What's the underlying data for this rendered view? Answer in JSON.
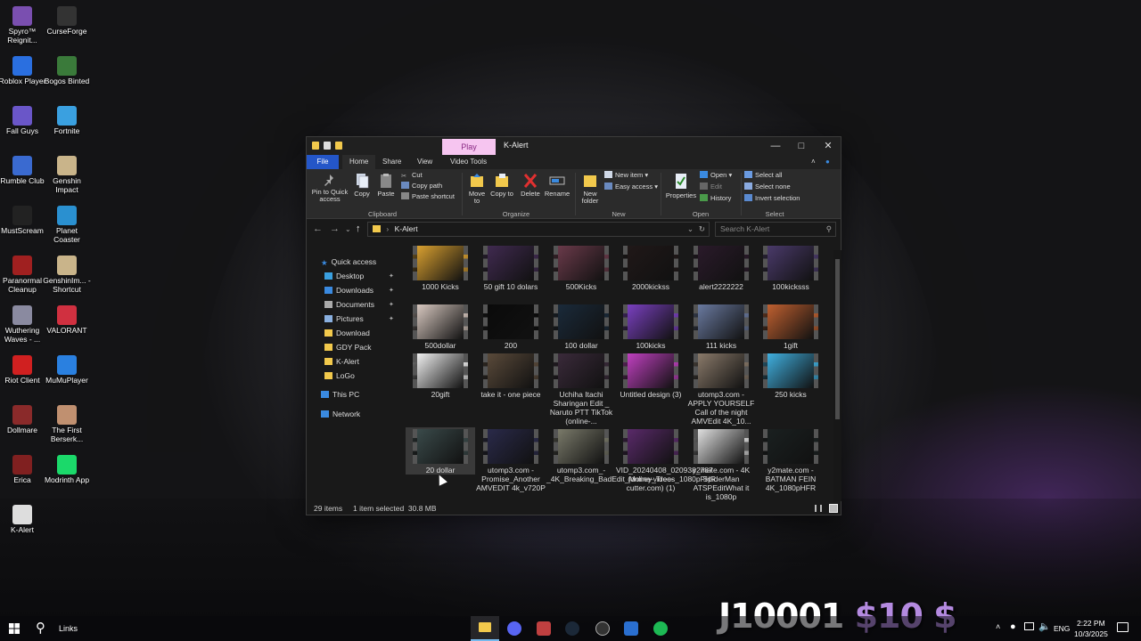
{
  "desktop": {
    "icons": [
      {
        "label": "Spyro™ Reignit...",
        "icon": "spyro-icon",
        "color": "#7a4fb0"
      },
      {
        "label": "CurseForge",
        "icon": "curseforge-icon",
        "color": "#333333"
      },
      {
        "label": "Roblox Player",
        "icon": "roblox-icon",
        "color": "#2a6fe0"
      },
      {
        "label": "Bogos Binted",
        "icon": "alien-icon",
        "color": "#3a7a3a"
      },
      {
        "label": "Fall Guys",
        "icon": "fallguys-icon",
        "color": "#6a56c8"
      },
      {
        "label": "Fortnite",
        "icon": "fortnite-icon",
        "color": "#3aa0e0"
      },
      {
        "label": "Rumble Club",
        "icon": "rumble-icon",
        "color": "#3a6ad0"
      },
      {
        "label": "Genshin Impact",
        "icon": "genshin-icon",
        "color": "#c9b48a"
      },
      {
        "label": "MustScream",
        "icon": "mustscream-icon",
        "color": "#222222"
      },
      {
        "label": "Planet Coaster",
        "icon": "planetcoaster-icon",
        "color": "#2a90d0"
      },
      {
        "label": "Paranormal Cleanup",
        "icon": "paranormal-icon",
        "color": "#a02020"
      },
      {
        "label": "GenshinIm... - Shortcut",
        "icon": "genshin-shortcut-icon",
        "color": "#c9b48a"
      },
      {
        "label": "Wuthering Waves - ...",
        "icon": "wuthering-icon",
        "color": "#8a8aa0"
      },
      {
        "label": "VALORANT",
        "icon": "valorant-icon",
        "color": "#d03040"
      },
      {
        "label": "Riot Client",
        "icon": "riot-icon",
        "color": "#d02020"
      },
      {
        "label": "MuMuPlayer",
        "icon": "mumu-icon",
        "color": "#2a80e0"
      },
      {
        "label": "Dollmare",
        "icon": "dollmare-icon",
        "color": "#8a2a2a"
      },
      {
        "label": "The First Berserk...",
        "icon": "berserker-icon",
        "color": "#c09070"
      },
      {
        "label": "Erica",
        "icon": "erica-icon",
        "color": "#802020"
      },
      {
        "label": "Modrinth App",
        "icon": "modrinth-icon",
        "color": "#1bd96a"
      },
      {
        "label": "K-Alert",
        "icon": "file-icon",
        "color": "#dddddd"
      }
    ]
  },
  "window": {
    "title": "K-Alert",
    "contextual_tab": "Play",
    "tabs": [
      "File",
      "Home",
      "Share",
      "View",
      "Video Tools"
    ],
    "ribbon": {
      "pin": "Pin to Quick access",
      "copy": "Copy",
      "paste": "Paste",
      "cut": "Cut",
      "copy_path": "Copy path",
      "paste_shortcut": "Paste shortcut",
      "move_to": "Move to",
      "copy_to": "Copy to",
      "delete": "Delete",
      "rename": "Rename",
      "new_folder": "New folder",
      "new_item": "New item",
      "easy_access": "Easy access",
      "properties": "Properties",
      "open": "Open",
      "edit": "Edit",
      "history": "History",
      "select_all": "Select all",
      "select_none": "Select none",
      "invert_selection": "Invert selection",
      "groups": {
        "clipboard": "Clipboard",
        "organize": "Organize",
        "new": "New",
        "open": "Open",
        "select": "Select"
      }
    },
    "address": {
      "path": "K-Alert",
      "search_placeholder": "Search K-Alert"
    },
    "nav": {
      "quick_access": "Quick access",
      "items": [
        {
          "label": "Desktop",
          "pinned": true,
          "color": "#3aa0e0"
        },
        {
          "label": "Downloads",
          "pinned": true,
          "color": "#3a8ae0"
        },
        {
          "label": "Documents",
          "pinned": true,
          "color": "#aaaaaa"
        },
        {
          "label": "Pictures",
          "pinned": true,
          "color": "#8ab0e0"
        },
        {
          "label": "Download",
          "pinned": false,
          "color": "#f2c94c"
        },
        {
          "label": "GDY Pack",
          "pinned": false,
          "color": "#f2c94c"
        },
        {
          "label": "K-Alert",
          "pinned": false,
          "color": "#f2c94c"
        },
        {
          "label": "LoGo",
          "pinned": false,
          "color": "#f2c94c"
        }
      ],
      "this_pc": "This PC",
      "network": "Network"
    },
    "files": [
      {
        "name": "1000 Kicks",
        "thumb": "#d9a030"
      },
      {
        "name": "50 gift 10 dolars",
        "thumb": "#402a50"
      },
      {
        "name": "500Kicks",
        "thumb": "#6a3a4a"
      },
      {
        "name": "2000kickss",
        "thumb": "#201818"
      },
      {
        "name": "alert2222222",
        "thumb": "#2a1a2a"
      },
      {
        "name": "100kicksss",
        "thumb": "#4a3a6a"
      },
      {
        "name": "500dollar",
        "thumb": "#d8c8c0"
      },
      {
        "name": "200",
        "thumb": "#0a0a0a"
      },
      {
        "name": "100 dollar",
        "thumb": "#1a2a3a"
      },
      {
        "name": "100kicks",
        "thumb": "#7a40c0"
      },
      {
        "name": "111 kicks",
        "thumb": "#6a7aa0"
      },
      {
        "name": "1gift",
        "thumb": "#c06030"
      },
      {
        "name": "20gift",
        "thumb": "#f0f0f0"
      },
      {
        "name": "take it - one piece",
        "thumb": "#5a4a3a"
      },
      {
        "name": "Uchiha Itachi Sharingan Edit _ Naruto PTT TikTok (online-...",
        "thumb": "#3a2a3a"
      },
      {
        "name": "Untitled design (3)",
        "thumb": "#c040c0"
      },
      {
        "name": "utomp3.com - APPLY YOURSELF Call of the night AMVEdit 4K_10...",
        "thumb": "#8a7a6a"
      },
      {
        "name": "250 kicks",
        "thumb": "#40b0e0"
      },
      {
        "name": "20 dollar",
        "thumb": "#3a4a4a",
        "selected": true
      },
      {
        "name": "utomp3.com - Promise_Another AMVEDIT 4k_v720P",
        "thumb": "#2a2a4a"
      },
      {
        "name": "utomp3.com_-_4K_Breaking_BadEdit_Money_Trees_1080pFHR",
        "thumb": "#7a7a6a"
      },
      {
        "name": "VID_20240408_020938_787 (online-video-cutter.com) (1)",
        "thumb": "#5a2a6a"
      },
      {
        "name": "y2mate.com - 4K SpiderMan ATSPEditWhat it is_1080p",
        "thumb": "#e0e0e0"
      },
      {
        "name": "y2mate.com - BATMAN FEIN 4K_1080pHFR",
        "thumb": "#1a2020"
      }
    ],
    "status": {
      "count": "29 items",
      "selection": "1 item selected  30.8 MB"
    }
  },
  "taskbar": {
    "search_label": "Links",
    "language": "ENG",
    "time": "2:22 PM",
    "date": "10/3/2025"
  },
  "overlay": {
    "name": "J10001",
    "money": "$10 $"
  }
}
